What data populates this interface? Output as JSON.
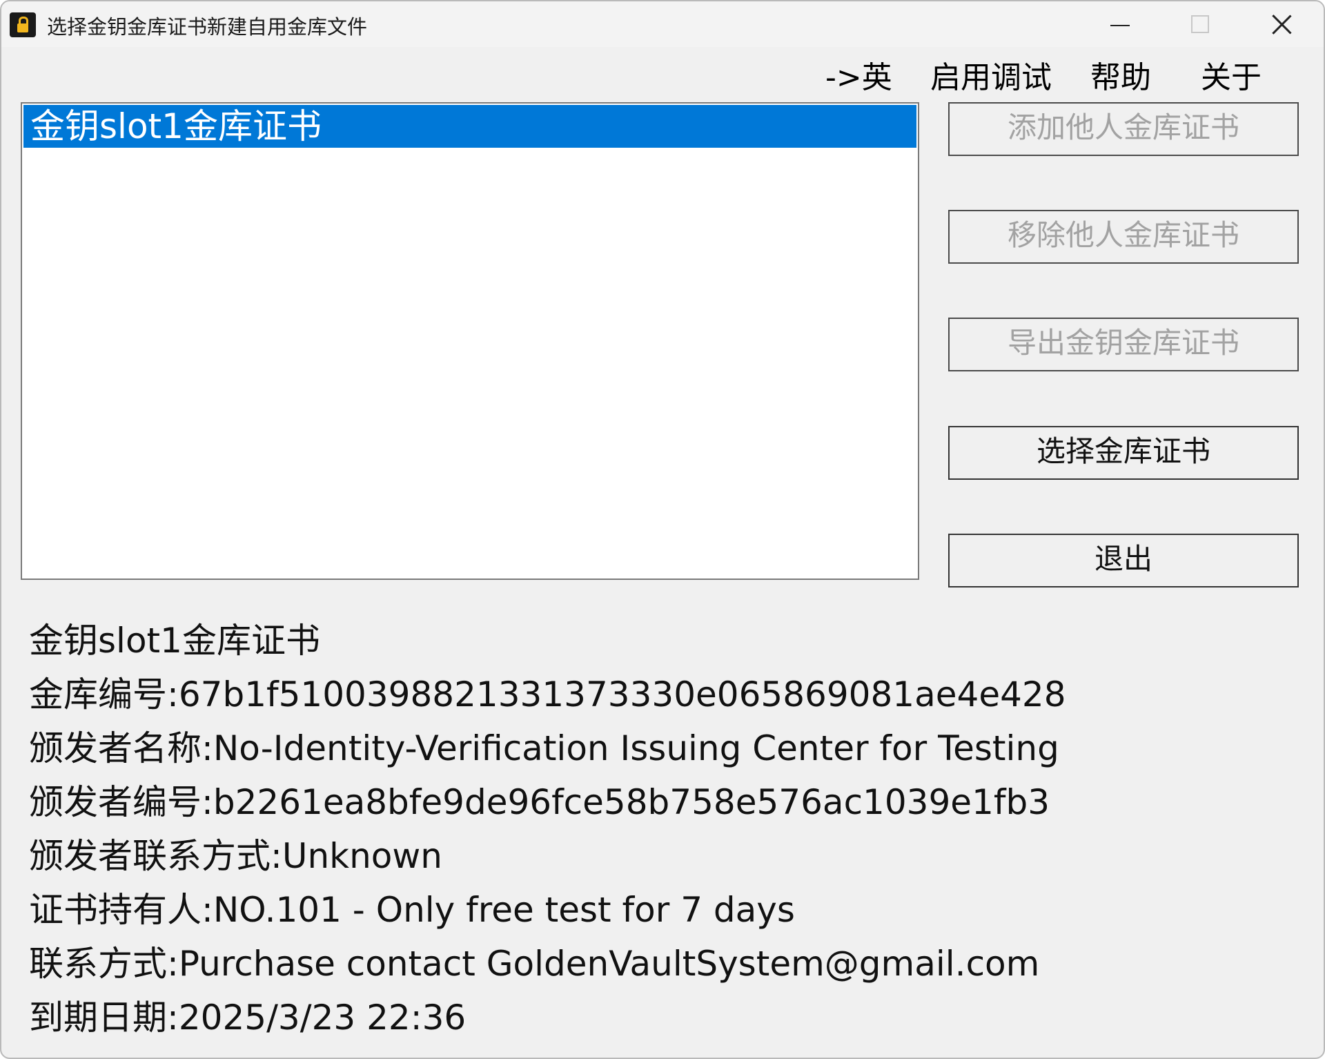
{
  "window": {
    "title": "选择金钥金库证书新建自用金库文件"
  },
  "menu": {
    "lang": "->英",
    "debug": "启用调试",
    "help": "帮助",
    "about": "关于"
  },
  "list": {
    "items": [
      "金钥slot1金库证书"
    ],
    "selected_index": 0
  },
  "buttons": {
    "add": "添加他人金库证书",
    "remove": "移除他人金库证书",
    "export": "导出金钥金库证书",
    "select": "选择金库证书",
    "exit": "退出"
  },
  "details": {
    "name": "金钥slot1金库证书",
    "vault_id": "金库编号:67b1f5100398821331373330e065869081ae4e428",
    "issuer_name": "颁发者名称:No-Identity-Verification Issuing Center for Testing",
    "issuer_id": "颁发者编号:b2261ea8bfe9de96fce58b758e576ac1039e1fb3",
    "issuer_contact": "颁发者联系方式:Unknown",
    "holder": "证书持有人:NO.101 - Only free test for 7 days",
    "contact": "联系方式:Purchase contact GoldenVaultSystem@gmail.com",
    "expiry": "到期日期:2025/3/23 22:36"
  },
  "icons": {
    "app": "lock-icon",
    "minimize": "minimize-icon",
    "maximize": "maximize-icon",
    "close": "close-icon"
  },
  "colors": {
    "selection": "#0078d7",
    "window_bg": "#f0f0f0",
    "disabled_text": "#a2a2a2"
  }
}
